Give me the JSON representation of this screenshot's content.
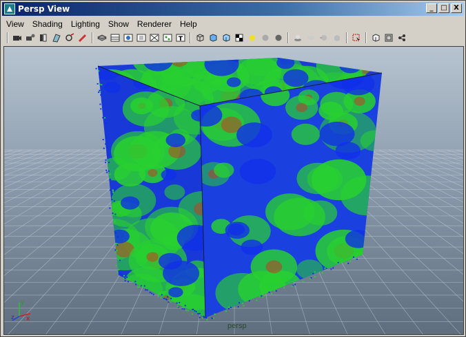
{
  "window": {
    "title": "Persp View"
  },
  "title_buttons": {
    "minimize": "_",
    "maximize": "□",
    "close": "X"
  },
  "menu": {
    "items": [
      {
        "label": "View"
      },
      {
        "label": "Shading"
      },
      {
        "label": "Lighting"
      },
      {
        "label": "Show"
      },
      {
        "label": "Renderer"
      },
      {
        "label": "Help"
      }
    ]
  },
  "toolbar": {
    "icons": [
      "select-camera-icon",
      "camera-attributes-icon",
      "bookmark-icon",
      "image-plane-icon",
      "film-gate-icon",
      "resolution-gate-icon",
      "grid-icon",
      "field-chart-icon",
      "wireframe-icon",
      "smooth-shade-icon",
      "flat-shade-icon",
      "bounding-box-icon",
      "points-icon",
      "texture-icon",
      "default-material-icon",
      "cube-wire-icon",
      "cube-solid-icon",
      "cube-light-icon",
      "checker-icon",
      "light-icon",
      "sphere-icon",
      "sphere-dark-icon",
      "shadow-icon",
      "ambient-occlusion-icon",
      "motion-blur-icon",
      "anti-alias-icon",
      "isolate-select-icon",
      "xray-icon",
      "xray-joints-icon",
      "xray-components-icon"
    ]
  },
  "viewport": {
    "camera_label": "persp",
    "axis_labels": {
      "y": "y",
      "x": "x",
      "z": "z"
    },
    "colors": {
      "low": "#1030e8",
      "mid": "#28d030",
      "high": "#c04020"
    }
  }
}
